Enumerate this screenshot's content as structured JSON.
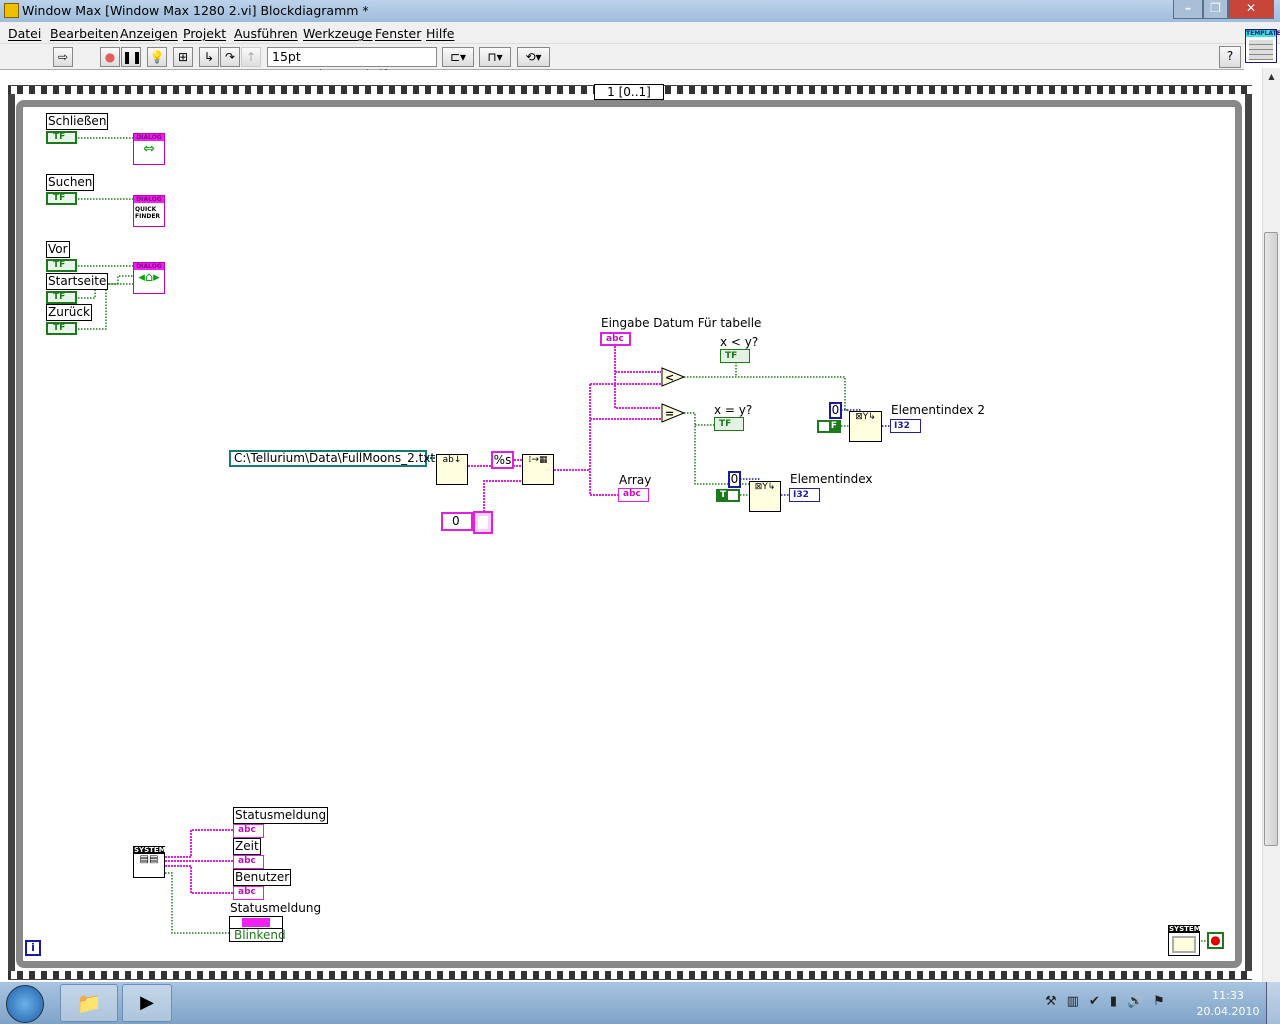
{
  "window": {
    "title": "Window Max [Window Max 1280 2.vi] Blockdiagramm *",
    "controls": [
      "–",
      "❐",
      "✕"
    ]
  },
  "menu": [
    "Datei",
    "Bearbeiten",
    "Anzeigen",
    "Projekt",
    "Ausführen",
    "Werkzeuge",
    "Fenster",
    "Hilfe"
  ],
  "toolbar": {
    "font": "15pt Anwendungsschriftart",
    "help": "?",
    "template": "TEMPLATE"
  },
  "sequence": {
    "frame": "1 [0..1]"
  },
  "diagram": {
    "buttons": [
      {
        "label": "Schließen",
        "dialog": "DIALOG"
      },
      {
        "label": "Suchen",
        "dialog": "DIALOG",
        "sub": "QUICK FINDER"
      },
      {
        "label": "Vor",
        "dialog": "DIALOG"
      },
      {
        "label": "Startseite"
      },
      {
        "label": "Zurück"
      }
    ],
    "tf": "TF",
    "eingabe": {
      "label": "Eingabe Datum Für tabelle",
      "type": "abc"
    },
    "less": {
      "label": "x < y?",
      "op": "<"
    },
    "equal": {
      "label": "x = y?",
      "op": "="
    },
    "path": "C:\\Tellurium\\Data\\FullMoons_2.txt",
    "format": "%s",
    "num0": "0",
    "array": {
      "label": "Array",
      "type": "abc"
    },
    "idx2": {
      "label": "Elementindex 2",
      "const": "0",
      "bool": "F",
      "type": "I32"
    },
    "idx": {
      "label": "Elementindex",
      "const": "0",
      "bool": "T",
      "type": "I32"
    },
    "system": "SYSTEM",
    "status": [
      {
        "label": "Statusmeldung"
      },
      {
        "label": "Zeit"
      },
      {
        "label": "Benutzer"
      }
    ],
    "status2": {
      "label": "Statusmeldung",
      "value": "Blinkend"
    },
    "info": "i"
  },
  "taskbar": {
    "time": "11:33",
    "date": "20.04.2010"
  }
}
